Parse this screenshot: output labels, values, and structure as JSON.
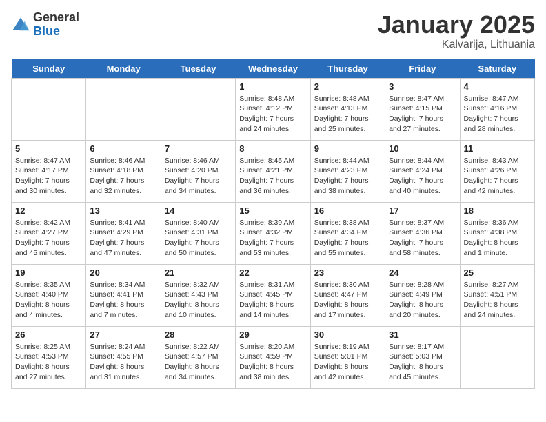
{
  "logo": {
    "general": "General",
    "blue": "Blue"
  },
  "title": "January 2025",
  "subtitle": "Kalvarija, Lithuania",
  "days_of_week": [
    "Sunday",
    "Monday",
    "Tuesday",
    "Wednesday",
    "Thursday",
    "Friday",
    "Saturday"
  ],
  "weeks": [
    [
      {
        "num": "",
        "sunrise": "",
        "sunset": "",
        "daylight": ""
      },
      {
        "num": "",
        "sunrise": "",
        "sunset": "",
        "daylight": ""
      },
      {
        "num": "",
        "sunrise": "",
        "sunset": "",
        "daylight": ""
      },
      {
        "num": "1",
        "sunrise": "Sunrise: 8:48 AM",
        "sunset": "Sunset: 4:12 PM",
        "daylight": "Daylight: 7 hours and 24 minutes."
      },
      {
        "num": "2",
        "sunrise": "Sunrise: 8:48 AM",
        "sunset": "Sunset: 4:13 PM",
        "daylight": "Daylight: 7 hours and 25 minutes."
      },
      {
        "num": "3",
        "sunrise": "Sunrise: 8:47 AM",
        "sunset": "Sunset: 4:15 PM",
        "daylight": "Daylight: 7 hours and 27 minutes."
      },
      {
        "num": "4",
        "sunrise": "Sunrise: 8:47 AM",
        "sunset": "Sunset: 4:16 PM",
        "daylight": "Daylight: 7 hours and 28 minutes."
      }
    ],
    [
      {
        "num": "5",
        "sunrise": "Sunrise: 8:47 AM",
        "sunset": "Sunset: 4:17 PM",
        "daylight": "Daylight: 7 hours and 30 minutes."
      },
      {
        "num": "6",
        "sunrise": "Sunrise: 8:46 AM",
        "sunset": "Sunset: 4:18 PM",
        "daylight": "Daylight: 7 hours and 32 minutes."
      },
      {
        "num": "7",
        "sunrise": "Sunrise: 8:46 AM",
        "sunset": "Sunset: 4:20 PM",
        "daylight": "Daylight: 7 hours and 34 minutes."
      },
      {
        "num": "8",
        "sunrise": "Sunrise: 8:45 AM",
        "sunset": "Sunset: 4:21 PM",
        "daylight": "Daylight: 7 hours and 36 minutes."
      },
      {
        "num": "9",
        "sunrise": "Sunrise: 8:44 AM",
        "sunset": "Sunset: 4:23 PM",
        "daylight": "Daylight: 7 hours and 38 minutes."
      },
      {
        "num": "10",
        "sunrise": "Sunrise: 8:44 AM",
        "sunset": "Sunset: 4:24 PM",
        "daylight": "Daylight: 7 hours and 40 minutes."
      },
      {
        "num": "11",
        "sunrise": "Sunrise: 8:43 AM",
        "sunset": "Sunset: 4:26 PM",
        "daylight": "Daylight: 7 hours and 42 minutes."
      }
    ],
    [
      {
        "num": "12",
        "sunrise": "Sunrise: 8:42 AM",
        "sunset": "Sunset: 4:27 PM",
        "daylight": "Daylight: 7 hours and 45 minutes."
      },
      {
        "num": "13",
        "sunrise": "Sunrise: 8:41 AM",
        "sunset": "Sunset: 4:29 PM",
        "daylight": "Daylight: 7 hours and 47 minutes."
      },
      {
        "num": "14",
        "sunrise": "Sunrise: 8:40 AM",
        "sunset": "Sunset: 4:31 PM",
        "daylight": "Daylight: 7 hours and 50 minutes."
      },
      {
        "num": "15",
        "sunrise": "Sunrise: 8:39 AM",
        "sunset": "Sunset: 4:32 PM",
        "daylight": "Daylight: 7 hours and 53 minutes."
      },
      {
        "num": "16",
        "sunrise": "Sunrise: 8:38 AM",
        "sunset": "Sunset: 4:34 PM",
        "daylight": "Daylight: 7 hours and 55 minutes."
      },
      {
        "num": "17",
        "sunrise": "Sunrise: 8:37 AM",
        "sunset": "Sunset: 4:36 PM",
        "daylight": "Daylight: 7 hours and 58 minutes."
      },
      {
        "num": "18",
        "sunrise": "Sunrise: 8:36 AM",
        "sunset": "Sunset: 4:38 PM",
        "daylight": "Daylight: 8 hours and 1 minute."
      }
    ],
    [
      {
        "num": "19",
        "sunrise": "Sunrise: 8:35 AM",
        "sunset": "Sunset: 4:40 PM",
        "daylight": "Daylight: 8 hours and 4 minutes."
      },
      {
        "num": "20",
        "sunrise": "Sunrise: 8:34 AM",
        "sunset": "Sunset: 4:41 PM",
        "daylight": "Daylight: 8 hours and 7 minutes."
      },
      {
        "num": "21",
        "sunrise": "Sunrise: 8:32 AM",
        "sunset": "Sunset: 4:43 PM",
        "daylight": "Daylight: 8 hours and 10 minutes."
      },
      {
        "num": "22",
        "sunrise": "Sunrise: 8:31 AM",
        "sunset": "Sunset: 4:45 PM",
        "daylight": "Daylight: 8 hours and 14 minutes."
      },
      {
        "num": "23",
        "sunrise": "Sunrise: 8:30 AM",
        "sunset": "Sunset: 4:47 PM",
        "daylight": "Daylight: 8 hours and 17 minutes."
      },
      {
        "num": "24",
        "sunrise": "Sunrise: 8:28 AM",
        "sunset": "Sunset: 4:49 PM",
        "daylight": "Daylight: 8 hours and 20 minutes."
      },
      {
        "num": "25",
        "sunrise": "Sunrise: 8:27 AM",
        "sunset": "Sunset: 4:51 PM",
        "daylight": "Daylight: 8 hours and 24 minutes."
      }
    ],
    [
      {
        "num": "26",
        "sunrise": "Sunrise: 8:25 AM",
        "sunset": "Sunset: 4:53 PM",
        "daylight": "Daylight: 8 hours and 27 minutes."
      },
      {
        "num": "27",
        "sunrise": "Sunrise: 8:24 AM",
        "sunset": "Sunset: 4:55 PM",
        "daylight": "Daylight: 8 hours and 31 minutes."
      },
      {
        "num": "28",
        "sunrise": "Sunrise: 8:22 AM",
        "sunset": "Sunset: 4:57 PM",
        "daylight": "Daylight: 8 hours and 34 minutes."
      },
      {
        "num": "29",
        "sunrise": "Sunrise: 8:20 AM",
        "sunset": "Sunset: 4:59 PM",
        "daylight": "Daylight: 8 hours and 38 minutes."
      },
      {
        "num": "30",
        "sunrise": "Sunrise: 8:19 AM",
        "sunset": "Sunset: 5:01 PM",
        "daylight": "Daylight: 8 hours and 42 minutes."
      },
      {
        "num": "31",
        "sunrise": "Sunrise: 8:17 AM",
        "sunset": "Sunset: 5:03 PM",
        "daylight": "Daylight: 8 hours and 45 minutes."
      },
      {
        "num": "",
        "sunrise": "",
        "sunset": "",
        "daylight": ""
      }
    ]
  ]
}
